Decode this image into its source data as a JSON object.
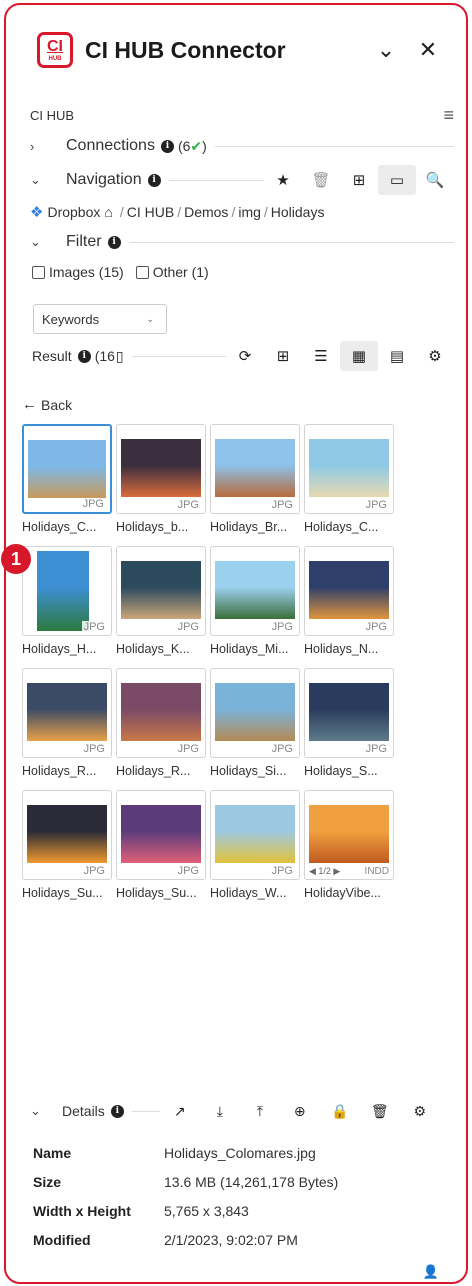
{
  "app": {
    "logo_line1": "CI",
    "logo_line2": "HUB",
    "title": "CI HUB Connector",
    "minimize_glyph": "⌄",
    "close_glyph": "✕",
    "section_label": "CI HUB",
    "menu_glyph": "≡"
  },
  "marker": {
    "label": "1"
  },
  "connections": {
    "chevron": "›",
    "title": "Connections",
    "count": "(6",
    "check": "✔",
    "count_close": ")"
  },
  "navigation": {
    "chevron": "⌄",
    "title": "Navigation",
    "tools": [
      {
        "icon": "star-icon",
        "glyph": "★"
      },
      {
        "icon": "trash-icon",
        "glyph": "🗑"
      },
      {
        "icon": "plus-square-icon",
        "glyph": "⊞"
      },
      {
        "icon": "folder-icon",
        "glyph": "▭"
      },
      {
        "icon": "search-icon",
        "glyph": "🔍"
      }
    ]
  },
  "breadcrumb": {
    "service_icon": "❖",
    "service": "Dropbox",
    "home_icon": "⌂",
    "parts": [
      "CI HUB",
      "Demos",
      "img",
      "Holidays"
    ]
  },
  "filter": {
    "chevron": "⌄",
    "title": "Filter",
    "options": [
      {
        "label": "Images (15)",
        "checked": false
      },
      {
        "label": "Other (1)",
        "checked": false
      }
    ],
    "dropdown_value": "Keywords",
    "dropdown_caret": "⌄"
  },
  "result": {
    "label": "Result",
    "count": "(16",
    "tools": [
      {
        "icon": "refresh-icon",
        "glyph": "⟳"
      },
      {
        "icon": "plus-square-icon",
        "glyph": "⊞"
      },
      {
        "icon": "list-view-icon",
        "glyph": "☰"
      },
      {
        "icon": "grid-view-icon",
        "glyph": "▦"
      },
      {
        "icon": "card-view-icon",
        "glyph": "▤"
      },
      {
        "icon": "settings-icon",
        "glyph": "⚙"
      }
    ]
  },
  "back": {
    "arrow": "←",
    "label": "Back"
  },
  "files": [
    {
      "name": "Holidays_C...",
      "ext": "JPG",
      "colors": [
        "#7db8e8",
        "#c79a5c"
      ]
    },
    {
      "name": "Holidays_b...",
      "ext": "JPG",
      "colors": [
        "#3a2e3f",
        "#d96c3c"
      ]
    },
    {
      "name": "Holidays_Br...",
      "ext": "JPG",
      "colors": [
        "#8ec2ea",
        "#b86a3b"
      ]
    },
    {
      "name": "Holidays_C...",
      "ext": "JPG",
      "colors": [
        "#8fc9e6",
        "#e6d9b0"
      ]
    },
    {
      "name": "Holidays_H...",
      "ext": "JPG",
      "colors": [
        "#3d8fd4",
        "#2d7a3e"
      ]
    },
    {
      "name": "Holidays_K...",
      "ext": "JPG",
      "colors": [
        "#2b4a5c",
        "#c9a77a"
      ]
    },
    {
      "name": "Holidays_Mi...",
      "ext": "JPG",
      "colors": [
        "#9bd0ee",
        "#3b6e3a"
      ]
    },
    {
      "name": "Holidays_N...",
      "ext": "JPG",
      "colors": [
        "#2e3f6b",
        "#e0953c"
      ]
    },
    {
      "name": "Holidays_R...",
      "ext": "JPG",
      "colors": [
        "#3b4b66",
        "#e8a24a"
      ]
    },
    {
      "name": "Holidays_R...",
      "ext": "JPG",
      "colors": [
        "#7a4a66",
        "#c9784a"
      ]
    },
    {
      "name": "Holidays_Si...",
      "ext": "JPG",
      "colors": [
        "#7ab3d8",
        "#b58a55"
      ]
    },
    {
      "name": "Holidays_S...",
      "ext": "JPG",
      "colors": [
        "#2a3b5e",
        "#5d7b8a"
      ]
    },
    {
      "name": "Holidays_Su...",
      "ext": "JPG",
      "colors": [
        "#2a2a38",
        "#f09a2e"
      ]
    },
    {
      "name": "Holidays_Su...",
      "ext": "JPG",
      "colors": [
        "#5b3b7a",
        "#e0607a"
      ]
    },
    {
      "name": "Holidays_W...",
      "ext": "JPG",
      "colors": [
        "#9cc9e2",
        "#e2c23a"
      ]
    },
    {
      "name": "HolidayVibe...",
      "ext": "INDD",
      "pager": "◀ 1/2 ▶",
      "colors": [
        "#f0a040",
        "#c05a20"
      ]
    }
  ],
  "details": {
    "chevron": "⌄",
    "title": "Details",
    "tools": [
      {
        "icon": "external-link-icon",
        "glyph": "↗"
      },
      {
        "icon": "download-icon",
        "glyph": "⤓"
      },
      {
        "icon": "upload-icon",
        "glyph": "⤒"
      },
      {
        "icon": "zoom-in-icon",
        "glyph": "⊕"
      },
      {
        "icon": "lock-icon",
        "glyph": "🔒"
      },
      {
        "icon": "trash-icon",
        "glyph": "🗑"
      },
      {
        "icon": "settings-icon",
        "glyph": "⚙"
      }
    ],
    "properties": [
      {
        "key": "Name",
        "value": "Holidays_Colomares.jpg"
      },
      {
        "key": "Size",
        "value": "13.6 MB (14,261,178 Bytes)"
      },
      {
        "key": "Width x Height",
        "value": "5,765 x 3,843"
      },
      {
        "key": "Modified",
        "value": "2/1/2023, 9:02:07 PM"
      }
    ]
  },
  "footer": {
    "user_glyph": "👤"
  },
  "colors": {
    "brand": "#d9182b",
    "accent": "#3b8fd8",
    "success": "#2db34a"
  }
}
